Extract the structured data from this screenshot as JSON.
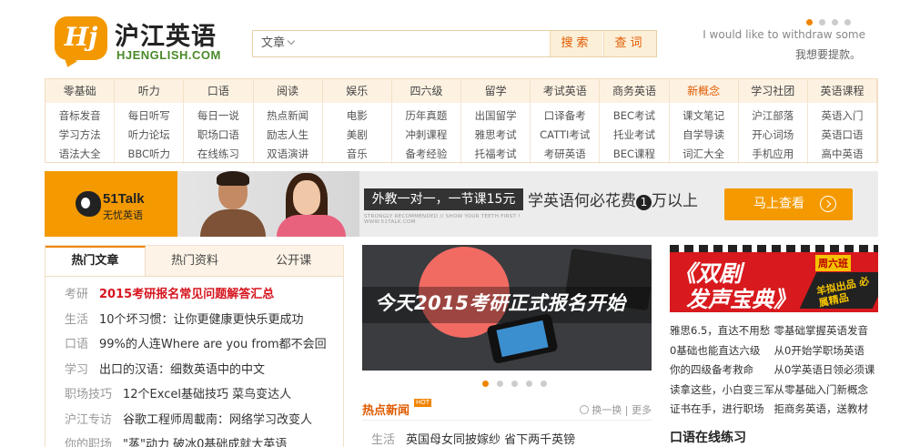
{
  "header": {
    "logo_badge": "Hj",
    "logo_cn": "沪江英语",
    "logo_en": "HJENGLISH.COM",
    "search_category": "文章",
    "search_placeholder": "",
    "search_button": "搜索",
    "query_button": "查词",
    "quote_en": "I would like to withdraw some",
    "quote_cn": "我想要提款。"
  },
  "categories": {
    "headers": [
      "零基础",
      "听力",
      "口语",
      "阅读",
      "娱乐",
      "四六级",
      "留学",
      "考试英语",
      "商务英语",
      "新概念",
      "学习社团",
      "英语课程"
    ],
    "highlight": "新概念",
    "columns": [
      [
        "音标发音",
        "学习方法",
        "语法大全"
      ],
      [
        "每日听写",
        "听力论坛",
        "BBC听力"
      ],
      [
        "每日一说",
        "职场口语",
        "在线练习"
      ],
      [
        "热点新闻",
        "励志人生",
        "双语演讲"
      ],
      [
        "电影",
        "美剧",
        "音乐"
      ],
      [
        "历年真题",
        "冲刺课程",
        "备考经验"
      ],
      [
        "出国留学",
        "雅思考试",
        "托福考试"
      ],
      [
        "口译备考",
        "CATTI考试",
        "考研英语"
      ],
      [
        "BEC考试",
        "托业考试",
        "BEC课程"
      ],
      [
        "课文笔记",
        "自学导读",
        "词汇大全"
      ],
      [
        "沪江部落",
        "开心词场",
        "手机应用"
      ],
      [
        "英语入门",
        "英语口语",
        "高中英语"
      ]
    ]
  },
  "banner": {
    "brand": "51Talk",
    "brand_cn": "无忧英语",
    "tag": "外教一对一，一节课15元",
    "small_text": "STRONGLY RECOMMENDED // SHOW YOUR TEETH FIRST !",
    "small_text_2": "WWW.51TALK.COM",
    "slogan_before": "学英语何必花费",
    "slogan_num": "1",
    "slogan_after": "万以上",
    "cta": "马上查看"
  },
  "articles": {
    "tabs": [
      "热门文章",
      "热门资料",
      "公开课"
    ],
    "rows": [
      {
        "cat": "考研",
        "title": "2015考研报名常见问题解答汇总",
        "hot": true
      },
      {
        "cat": "生活",
        "title": "10个坏习惯：让你更健康更快乐更成功",
        "hot": false
      },
      {
        "cat": "口语",
        "title": "99%的人连Where are you from都不会回",
        "hot": false
      },
      {
        "cat": "学习",
        "title": "出口的汉语：细数英语中的中文",
        "hot": false
      },
      {
        "cat": "职场技巧",
        "title": "12个Excel基础技巧 菜鸟变达人",
        "hot": false
      },
      {
        "cat": "沪江专访",
        "title": "谷歌工程师周載南：网络学习改变人",
        "hot": false
      },
      {
        "cat": "你的职场",
        "title": "\"蒸\"动力  破冰0基础成就大英语",
        "hot": false
      }
    ]
  },
  "slide": {
    "headline": "今天2015考研正式报名开始"
  },
  "hot_news": {
    "title": "热点新闻",
    "badge": "HOT",
    "refresh": "换一换",
    "more": "更多",
    "row_cat": "生活",
    "row_title": "英国母女同披嫁纱 省下两千英镑"
  },
  "promo": {
    "line1": "《双剧",
    "tag": "周六班",
    "line2": "发声宝典》",
    "corner": "羊拟出品 必属精品"
  },
  "right_list": [
    [
      "雅思6.5，直达不用愁",
      "零基础掌握英语发音"
    ],
    [
      "0基础也能直达六级",
      "从0开始学职场英语"
    ],
    [
      "你的四级备考救命",
      "从0学英语日领必须课"
    ],
    [
      "读拿这些，小白变三军",
      "从零基础入门新概念"
    ],
    [
      "证书在手，进行职场",
      "拒商务英语，送教材"
    ]
  ],
  "right_heading": "口语在线练习",
  "colors": {
    "accent": "#f08400",
    "hot_red": "#d6141e",
    "nav_bg": "#fdf2e2",
    "banner_orange": "#f49a00"
  }
}
